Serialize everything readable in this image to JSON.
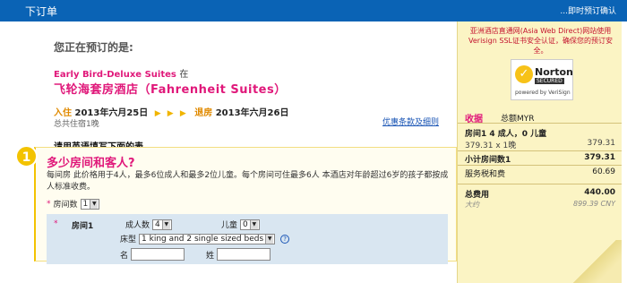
{
  "header": {
    "title": "下订单",
    "instant_confirm": "...即时预订确认"
  },
  "booking": {
    "heading": "您正在预订的是:",
    "room_name": "Early Bird-Deluxe Suites",
    "room_at": "在",
    "hotel_name": "飞轮海套房酒店（Fahrenheit Suites）",
    "checkin_label": "入住",
    "checkin_date": "2013年六月25日",
    "checkout_label": "退房",
    "checkout_date": "2013年六月26日",
    "arrows": "▶ ▶ ▶",
    "nights": "总共住宿1晚",
    "terms_link": "优惠条款及细则",
    "english_note": "请用英语填写下面的表。"
  },
  "step1": {
    "number": "1",
    "title": "多少房间和客人?",
    "description": "每间房 此价格用于4人，最多6位成人和最多2位儿童。每个房间可住最多6人 本酒店对年龄超过6岁的孩子都按成人标准收费。",
    "rooms_label": "房间数",
    "rooms_value": "1",
    "room1": {
      "label": "房间1",
      "adults_label": "成人数",
      "adults_value": "4",
      "children_label": "儿童",
      "children_value": "0",
      "bed_label": "床型",
      "bed_value": "1 king and 2 single sized beds",
      "first_name_label": "名",
      "last_name_label": "姓"
    }
  },
  "sidebar": {
    "notice": "亚洲酒店直通网(Asia Web Direct)网站使用Verisign SSL证书安全认证，确保您的预订安全。",
    "badge": {
      "check": "✓",
      "brand": "Norton",
      "secured": "SECURED",
      "powered": "powered by VeriSign"
    },
    "receipt_label": "收据",
    "total_currency_label": "总额MYR",
    "room_line_label": "房间1 4 成人，0 儿童",
    "room_line_detail": "379.31 x 1晚",
    "room_line_amount": "379.31",
    "subtotal_label": "小计房间数1",
    "subtotal_amount": "379.31",
    "tax_label": "服务税和费",
    "tax_amount": "60.69",
    "total_label": "总费用",
    "total_amount": "440.00",
    "approx_label": "大约",
    "approx_amount": "899.39 CNY"
  }
}
